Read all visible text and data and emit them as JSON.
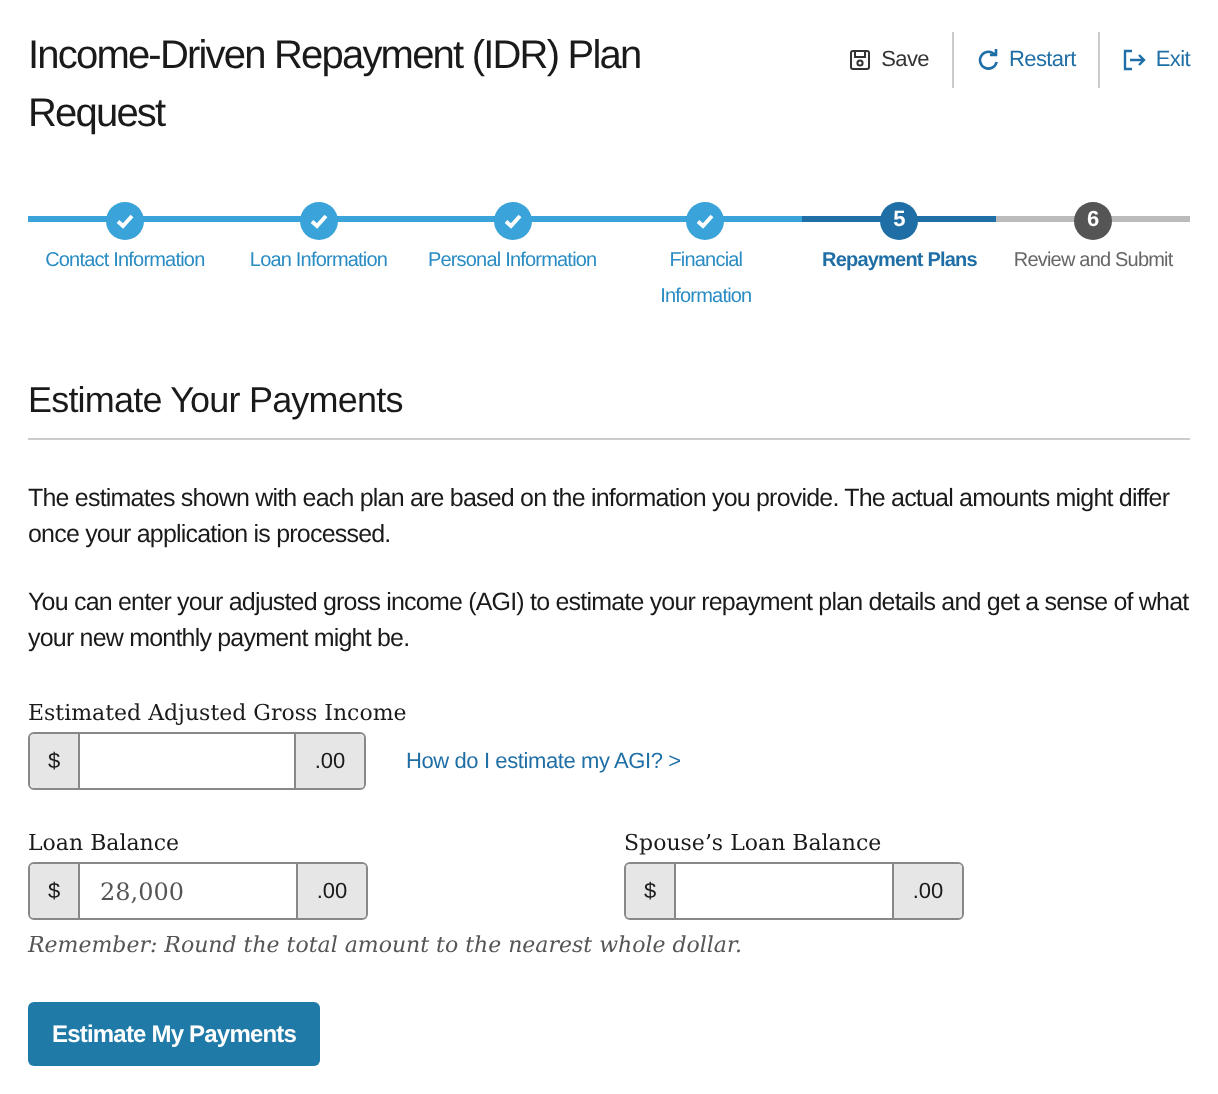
{
  "header": {
    "title": "Income-Driven Repayment (IDR) Plan Request",
    "actions": [
      {
        "kind": "save",
        "label": "Save"
      },
      {
        "kind": "restart",
        "label": "Restart"
      },
      {
        "kind": "exit",
        "label": "Exit"
      }
    ]
  },
  "steps": [
    {
      "label": "Contact Information",
      "completed": true,
      "selected": false
    },
    {
      "label": "Loan Information",
      "completed": true,
      "selected": false
    },
    {
      "label": "Personal Information",
      "completed": true,
      "selected": false
    },
    {
      "label": "Financial Information",
      "completed": true,
      "selected": false
    },
    {
      "label": "Repayment Plans",
      "completed": false,
      "selected": true,
      "number": "5"
    },
    {
      "label": "Review and Submit",
      "completed": false,
      "selected": false,
      "number": "6"
    }
  ],
  "section": {
    "heading": "Estimate Your Payments",
    "paragraphs": [
      "The estimates shown with each plan are based on the information you provide. The actual amounts might differ once your application is processed.",
      "You can enter your adjusted gross income (AGI) to estimate your repayment plan details and get a sense of what your new monthly payment might be."
    ]
  },
  "agi": {
    "label": "Estimated Adjusted Gross Income",
    "prefix": "$",
    "suffix": ".00",
    "help_link": "How do I estimate my AGI? >"
  },
  "balances": [
    {
      "label": "Loan Balance",
      "prefix": "$",
      "value": "28,000",
      "suffix": ".00"
    },
    {
      "label": "Spouse’s Loan Balance",
      "prefix": "$",
      "suffix": ".00"
    }
  ],
  "note": "Remember: Round the total amount to the nearest whole dollar.",
  "submit": {
    "label": "Estimate My Payments"
  }
}
